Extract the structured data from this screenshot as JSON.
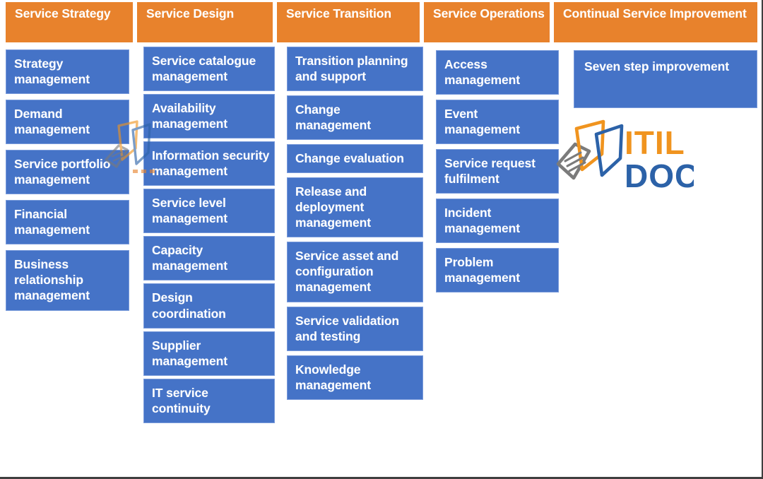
{
  "colors": {
    "header_orange": "#E8822C",
    "box_blue": "#4573C7",
    "box_border": "#7A9BDB",
    "text_white": "#FFFFFF",
    "logo_orange": "#F0941F",
    "logo_blue": "#2C62A8",
    "logo_gray": "#7B7B7B",
    "page_background": "#FFFFFF",
    "frame_border": "#3F3F3F"
  },
  "columns": [
    {
      "header": "Service Strategy",
      "items": [
        "Strategy management",
        "Demand management",
        "Service portfolio management",
        "Financial management",
        "Business relationship management"
      ]
    },
    {
      "header": "Service Design",
      "items": [
        "Service catalogue management",
        "Availability management",
        "Information security management",
        "Service level management",
        "Capacity management",
        "Design coordination",
        "Supplier management",
        "IT service continuity"
      ]
    },
    {
      "header": "Service Transition",
      "items": [
        "Transition planning and support",
        "Change management",
        "Change evaluation",
        "Release and deployment management",
        "Service asset and configuration management",
        "Service validation and testing",
        "Knowledge management"
      ]
    },
    {
      "header": "Service Operations",
      "items": [
        "Access management",
        "Event management",
        "Service request fulfilment",
        "Incident management",
        "Problem management"
      ]
    },
    {
      "header": "Continual Service Improvement",
      "items": [
        "Seven step improvement"
      ]
    }
  ],
  "logo": {
    "word_one": "ITIL",
    "word_two": "DOCS",
    "mark_name": "stacked-documents-icon"
  }
}
